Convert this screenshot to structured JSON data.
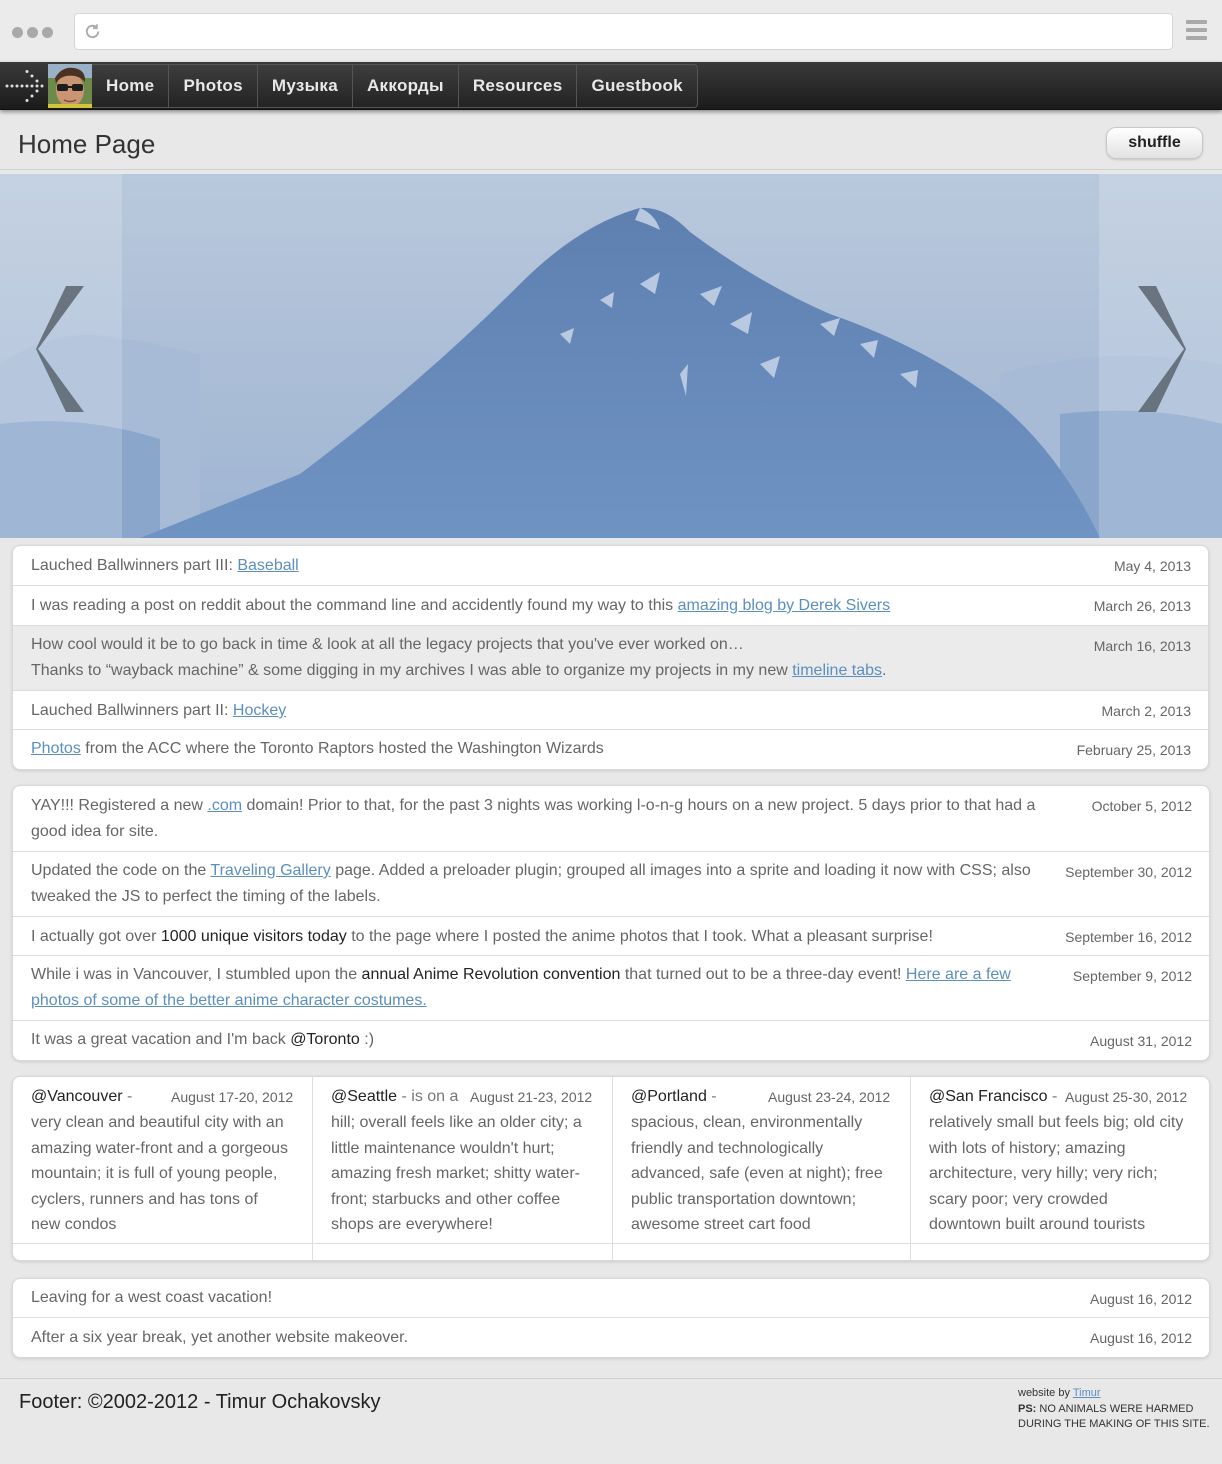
{
  "browser": {
    "menu_icon": "hamburger-icon",
    "reload_icon": "reload-icon"
  },
  "nav": {
    "items": [
      "Home",
      "Photos",
      "Музыка",
      "Аккорды",
      "Resources",
      "Guestbook"
    ]
  },
  "header": {
    "title": "Home Page",
    "shuffle_label": "shuffle"
  },
  "slider": {
    "prev_icon": "chevron-left-icon",
    "next_icon": "chevron-right-icon"
  },
  "news1": [
    {
      "prefix": "Lauched Ballwinners part III: ",
      "link": "Baseball",
      "date": "May 4, 2013"
    },
    {
      "prefix": "I was reading a post on reddit about the command line and accidently found my way to this ",
      "link": "amazing blog by Derek Sivers",
      "date": "March 26, 2013"
    },
    {
      "line1": "How cool would it be to go back in time & look at all the legacy projects that you've ever worked on…",
      "prefix": "Thanks to “wayback machine” & some digging in my archives I was able to organize my projects in my new ",
      "link": "timeline tabs",
      "suffix": ".",
      "date": "March 16, 2013"
    },
    {
      "prefix": "Lauched Ballwinners part II: ",
      "link": "Hockey",
      "date": "March 2, 2013"
    },
    {
      "link": "Photos",
      "suffix": " from the ACC where the Toronto Raptors hosted the Washington Wizards",
      "date": "February 25, 2013"
    }
  ],
  "news2": [
    {
      "prefix": "YAY!!! Registered a new ",
      "link": " .com",
      "suffix": " domain! Prior to that, for the past 3 nights was working l-o-n-g hours on a new project. 5 days prior to that had a good idea for site.",
      "date": "October 5, 2012"
    },
    {
      "prefix": "Updated the code on the ",
      "link": "Traveling Gallery",
      "suffix": " page. Added a preloader plugin; grouped all images into a sprite and loading it now with CSS; also tweaked the JS to perfect the timing of the labels.",
      "date": "September 30, 2012"
    },
    {
      "prefix": "I actually got over ",
      "strong": "1000 unique visitors today",
      "suffix": " to the page where I posted the anime photos that I took. What a pleasant surprise!",
      "date": "September 16, 2012"
    },
    {
      "prefix": "While i was in Vancouver, I stumbled upon the ",
      "strong": "annual Anime Revolution convention",
      "mid": " that turned out to be a three-day event! ",
      "link": "Here are a few photos of some of the better anime character costumes.",
      "date": "September 9, 2012"
    },
    {
      "prefix": "It was a great vacation and I'm back ",
      "strong": "@Toronto",
      "suffix": " :)",
      "date": "August 31, 2012"
    }
  ],
  "cities": [
    {
      "name": "@Vancouver",
      "sep": " -",
      "date": "August 17-20, 2012",
      "lines": [
        "very clean and beautiful city with an",
        "amazing water-front and a gorgeous",
        "mountain; it is full of young people,",
        "cyclers, runners and has tons of",
        "new condos"
      ]
    },
    {
      "name": "@Seattle",
      "sep": " - is on a",
      "date": "August 21-23, 2012",
      "lines": [
        "hill; overall feels like an older city; a",
        "little maintenance wouldn't hurt;",
        "amazing fresh market; shitty water-",
        "front; starbucks and other coffee",
        "shops are everywhere!"
      ]
    },
    {
      "name": "@Portland",
      "sep": " -",
      "date": "August 23-24, 2012",
      "lines": [
        "spacious, clean, environmentally",
        "friendly and technologically",
        "advanced, safe (even at night); free",
        "public transportation downtown;",
        "awesome street cart food"
      ]
    },
    {
      "name": "@San Francisco",
      "sep": " -",
      "date": "August 25-30, 2012",
      "lines": [
        "relatively small but feels big; old city",
        "with lots of history; amazing",
        "architecture, very hilly; very rich;",
        "scary poor; very crowded",
        "downtown built around tourists"
      ]
    }
  ],
  "news3": [
    {
      "prefix": "Leaving for a west coast vacation!",
      "date": "August 16, 2012"
    },
    {
      "prefix": "After a six year break, yet another website makeover.",
      "date": "August 16, 2012"
    }
  ],
  "footer": {
    "text": "Footer: ©2002-2012 - Timur Ochakovsky",
    "credit_prefix": "website by ",
    "credit_link": "Timur",
    "ps_label": "PS:",
    "ps_text1": " NO ANIMALS WERE HARMED",
    "ps_text2": "DURING THE MAKING OF THIS SITE."
  }
}
